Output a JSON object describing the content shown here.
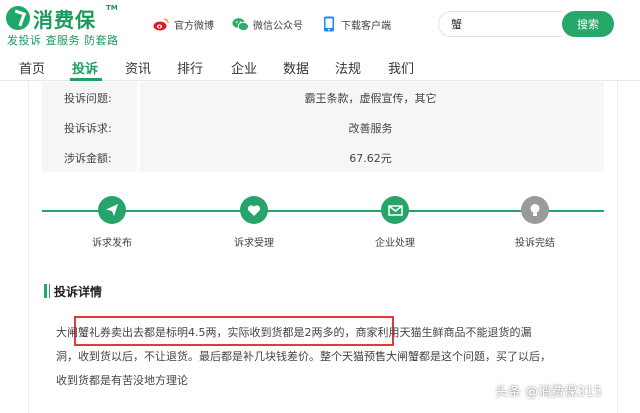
{
  "brand": {
    "name": "消费保",
    "tm": "TM",
    "slogan": "发投诉 查服务 防套路",
    "color": "#1a9a5c"
  },
  "header_links": [
    {
      "label": "官方微博",
      "icon": "weibo-icon"
    },
    {
      "label": "微信公众号",
      "icon": "wechat-icon"
    },
    {
      "label": "下载客户端",
      "icon": "phone-icon"
    }
  ],
  "search": {
    "value": "蟹",
    "button": "搜索"
  },
  "nav": {
    "items": [
      "首页",
      "投诉",
      "资讯",
      "排行",
      "企业",
      "数据",
      "法规",
      "我们"
    ],
    "active": "投诉"
  },
  "complaint_info": [
    {
      "key": "投诉问题:",
      "value": "霸王条款，虚假宣传，其它"
    },
    {
      "key": "投诉诉求:",
      "value": "改善服务"
    },
    {
      "key": "涉诉金额:",
      "value": "67.62元"
    }
  ],
  "steps": [
    {
      "label": "诉求发布",
      "icon": "send-icon",
      "status": "done"
    },
    {
      "label": "诉求受理",
      "icon": "heart-icon",
      "status": "done"
    },
    {
      "label": "企业处理",
      "icon": "mail-icon",
      "status": "done"
    },
    {
      "label": "投诉完结",
      "icon": "bulb-icon",
      "status": "pending"
    }
  ],
  "details": {
    "title": "投诉详情",
    "lines": [
      "大闸蟹礼券卖出去都是标明4.5两，实际收到货都是2两多的，商家利用天猫生鲜商品不能退货的漏",
      "洞，收到货以后，不让退货。最后都是补几块钱差价。整个天猫预售大闸蟹都是这个问题，买了以后，",
      "收到货都是有苦没地方理论"
    ]
  },
  "watermark": "头条 @消费保315",
  "colors": {
    "accent": "#26a86a",
    "highlight": "#e23a3a",
    "pending": "#9a9a9a"
  }
}
